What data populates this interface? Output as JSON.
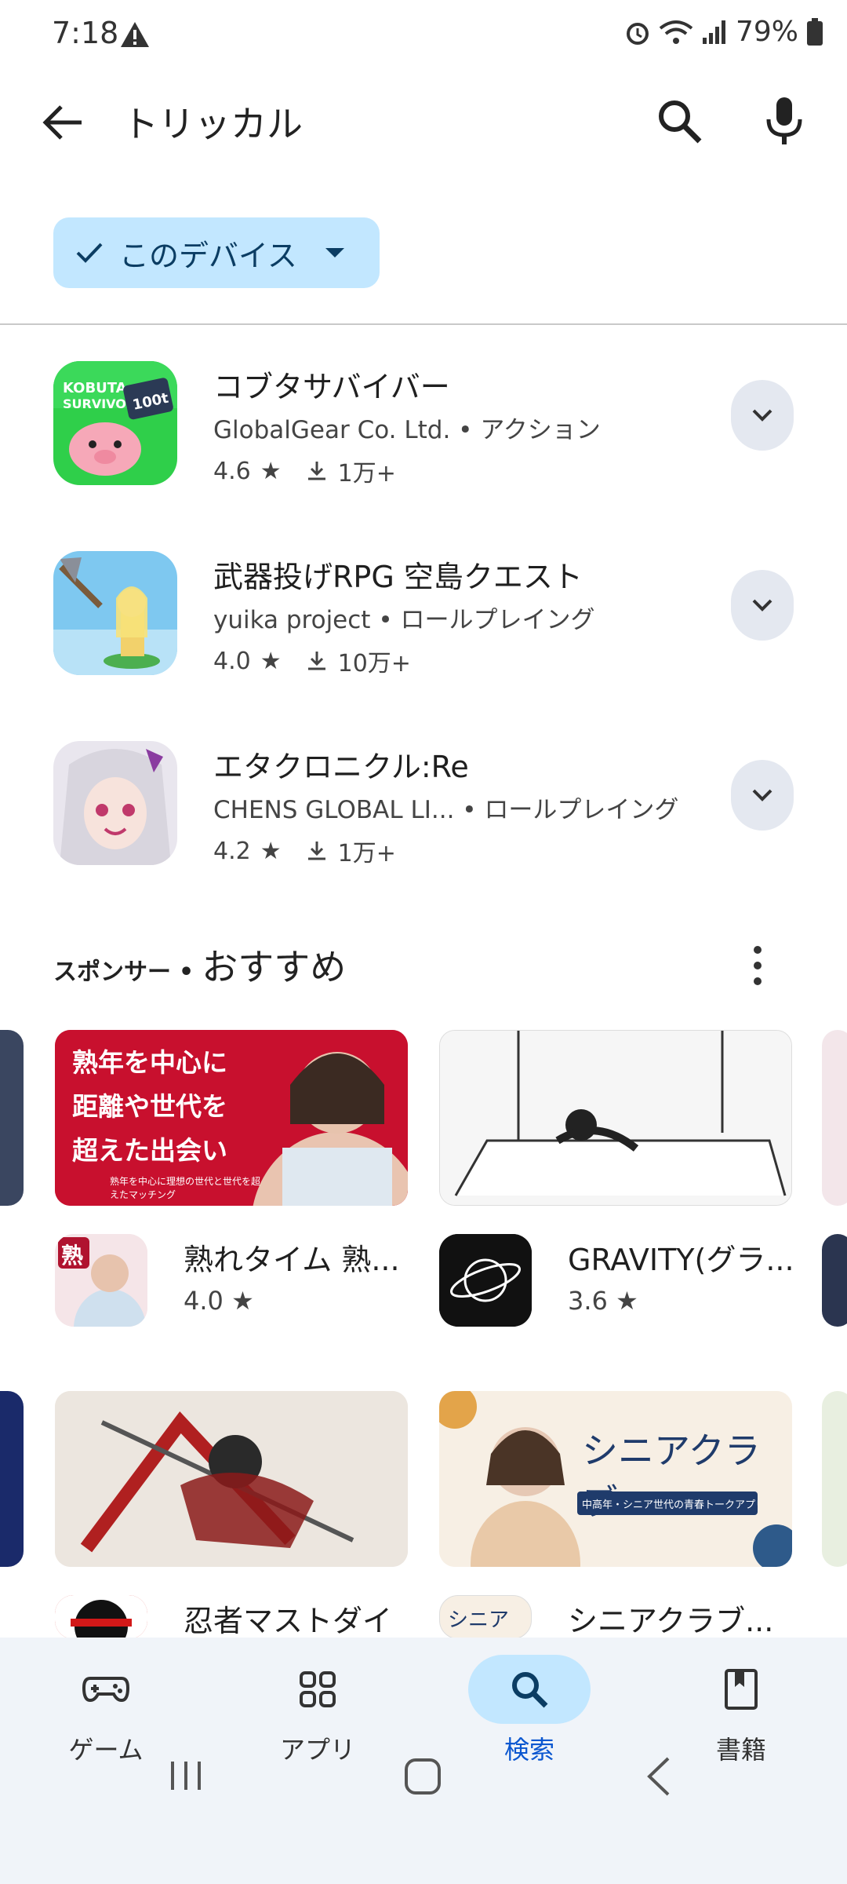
{
  "status": {
    "time": "7:18",
    "battery": "79%"
  },
  "search": {
    "query": "トリッカル"
  },
  "filter_chip": {
    "label": "このデバイス"
  },
  "results": [
    {
      "name": "コブタサバイバー",
      "developer": "GlobalGear Co. Ltd.",
      "category": "アクション",
      "rating": "4.6",
      "downloads": "1万+"
    },
    {
      "name": "武器投げRPG 空島クエスト",
      "developer": "yuika project",
      "category": "ロールプレイング",
      "rating": "4.0",
      "downloads": "10万+"
    },
    {
      "name": "エタクロニクル:Re",
      "developer": "CHENS GLOBAL LI...",
      "category": "ロールプレイング",
      "rating": "4.2",
      "downloads": "1万+"
    }
  ],
  "sponsored": {
    "sponsor_label": "スポンサー",
    "title": "おすすめ",
    "cards": [
      {
        "name": "熟れタイム 熟...",
        "rating": "4.0",
        "banner_lines": [
          "熟年を中心に",
          "距離や世代を",
          "超えた出会い"
        ],
        "banner_sub": "熟年を中心に理想の世代と世代を超えたマッチング",
        "icon_text": "熟"
      },
      {
        "name": "GRAVITY(グラ...",
        "rating": "3.6"
      },
      {
        "name": "忍者マストダイ",
        "rating": ""
      },
      {
        "name": "シニアクラブ...",
        "rating": "",
        "banner_title": "シニアクラブ",
        "banner_sub": "中高年・シニア世代の青春トークアプリ",
        "icon_text": "シニア"
      }
    ]
  },
  "bottom_nav": [
    {
      "label": "ゲーム",
      "icon": "gamepad-icon"
    },
    {
      "label": "アプリ",
      "icon": "apps-grid-icon"
    },
    {
      "label": "検索",
      "icon": "search-icon"
    },
    {
      "label": "書籍",
      "icon": "book-icon"
    }
  ],
  "colors": {
    "chip_bg": "#c2e7ff",
    "active": "#0b57d0",
    "nav_bg": "#f0f4f9"
  }
}
